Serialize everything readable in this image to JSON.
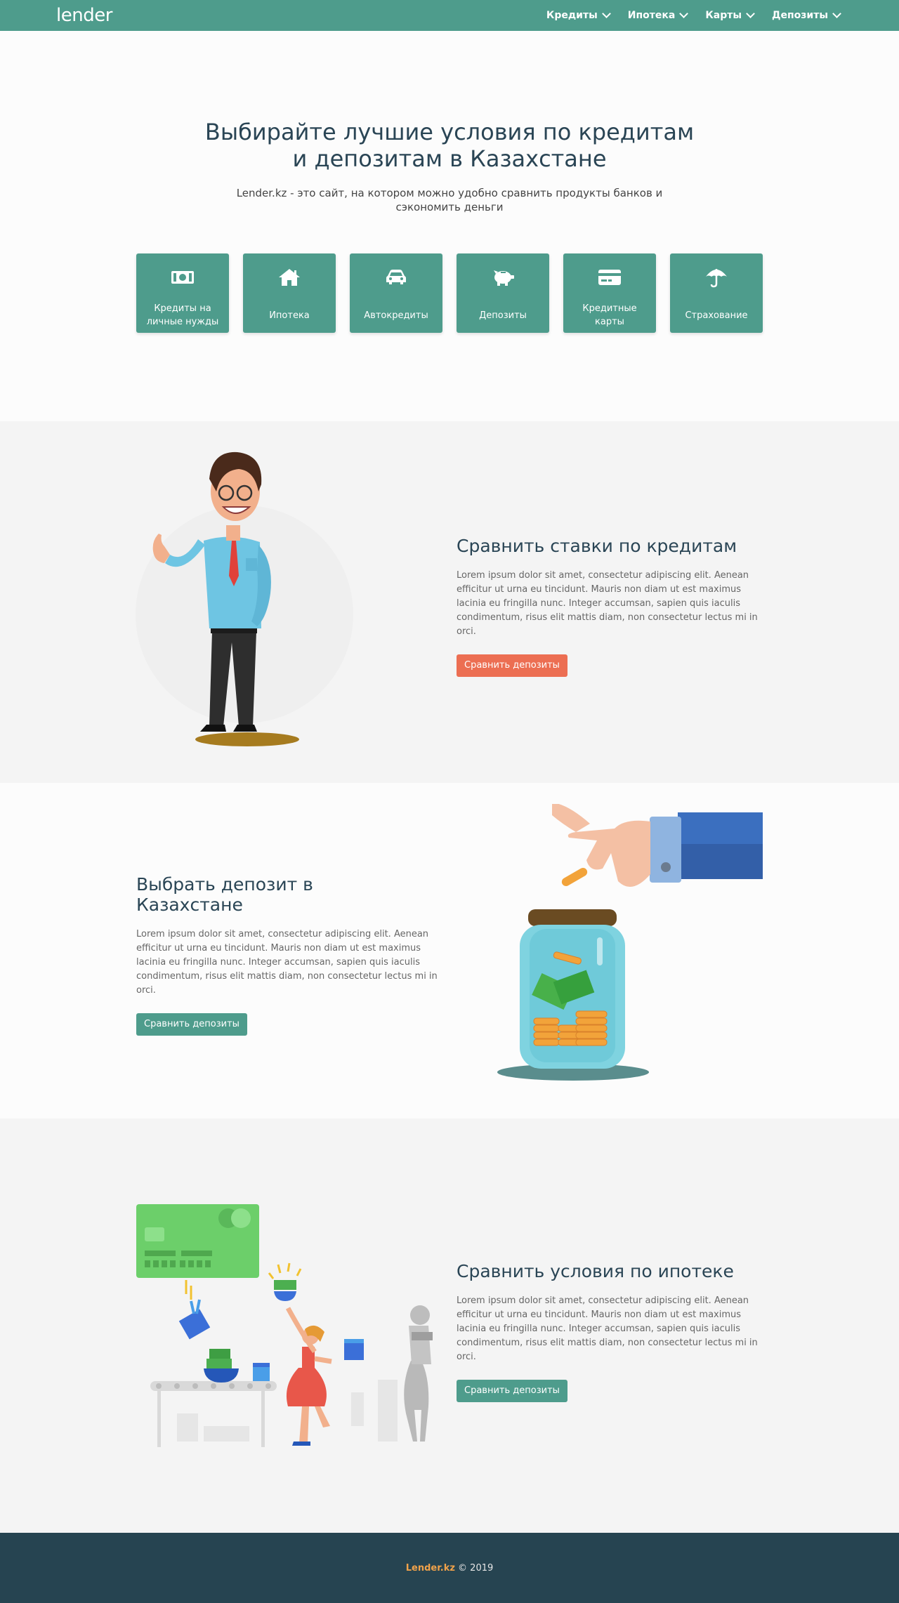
{
  "nav": {
    "logo": "lender",
    "items": [
      {
        "label": "Кредиты"
      },
      {
        "label": "Ипотека"
      },
      {
        "label": "Карты"
      },
      {
        "label": "Депозиты"
      }
    ]
  },
  "hero": {
    "title": "Выбирайте лучшие условия по кредитам и депозитам в Казахстане",
    "subtitle": "Lender.kz - это сайт, на котором можно удобно сравнить продукты банков и сэкономить деньги",
    "tiles": [
      {
        "label": "Кредиты на личные нужды",
        "icon": "money-icon"
      },
      {
        "label": "Ипотека",
        "icon": "home-icon"
      },
      {
        "label": "Автокредиты",
        "icon": "car-icon"
      },
      {
        "label": "Депозиты",
        "icon": "piggy-bank-icon"
      },
      {
        "label": "Кредитные карты",
        "icon": "credit-card-icon"
      },
      {
        "label": "Страхование",
        "icon": "umbrella-icon"
      }
    ]
  },
  "sections": [
    {
      "title": "Сравнить ставки по кредитам",
      "text": "Lorem ipsum dolor sit amet, consectetur adipiscing elit. Aenean efficitur ut urna eu tincidunt. Mauris non diam ut est maximus lacinia eu fringilla nunc. Integer accumsan, sapien quis iaculis condimentum, risus elit mattis diam, non consectetur lectus mi in orci.",
      "button": "Сравнить депозиты",
      "button_color": "#ec6e52"
    },
    {
      "title": "Выбрать депозит в Казахстане",
      "text": "Lorem ipsum dolor sit amet, consectetur adipiscing elit. Aenean efficitur ut urna eu tincidunt. Mauris non diam ut est maximus lacinia eu fringilla nunc. Integer accumsan, sapien quis iaculis condimentum, risus elit mattis diam, non consectetur lectus mi in orci.",
      "button": "Сравнить депозиты",
      "button_color": "#4e9c8c"
    },
    {
      "title": "Сравнить условия по ипотеке",
      "text": "Lorem ipsum dolor sit amet, consectetur adipiscing elit. Aenean efficitur ut urna eu tincidunt. Mauris non diam ut est maximus lacinia eu fringilla nunc. Integer accumsan, sapien quis iaculis condimentum, risus elit mattis diam, non consectetur lectus mi in orci.",
      "button": "Сравнить депозиты",
      "button_color": "#4e9c8c"
    }
  ],
  "footer": {
    "brand": "Lender.kz",
    "copyright": " © 2019"
  },
  "colors": {
    "primary": "#4e9c8c",
    "accent": "#ec6e52",
    "heading": "#2a4555",
    "footer_bg": "#264451",
    "footer_brand": "#f0a24a"
  }
}
